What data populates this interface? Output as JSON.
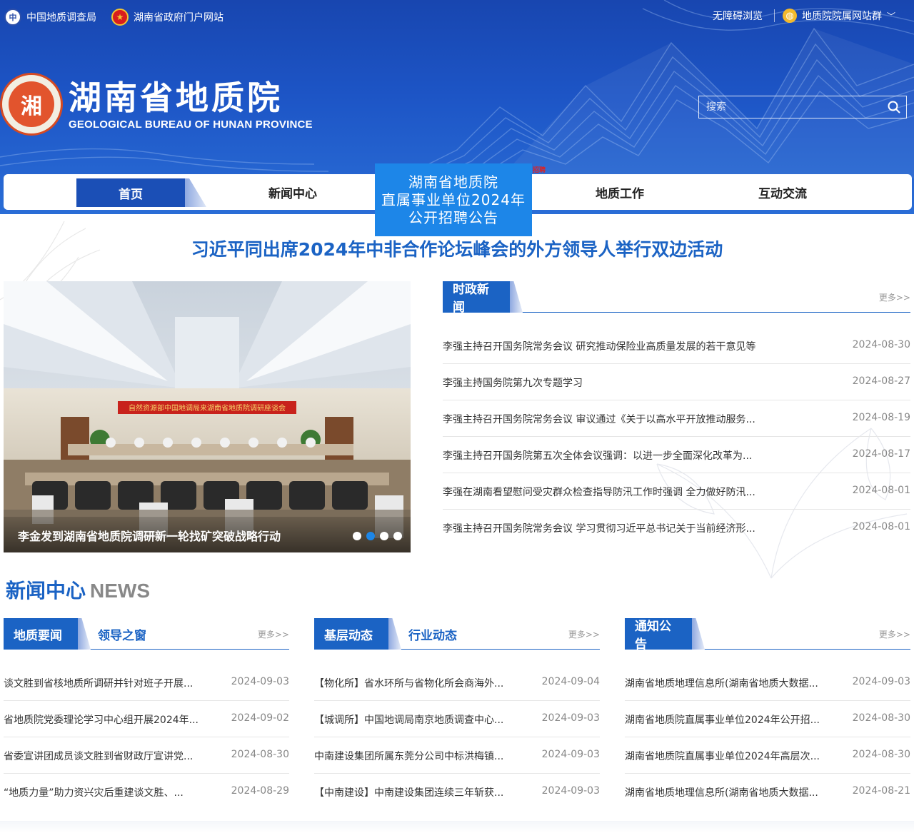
{
  "topbar": {
    "left_links": [
      "中国地质调查局",
      "湖南省政府门户网站"
    ],
    "accessibility": "无障碍浏览",
    "site_group": "地质院院属网站群"
  },
  "logo": {
    "cn": "湖南省地质院",
    "en": "GEOLOGICAL BUREAU OF HUNAN PROVINCE",
    "emblem": "湘"
  },
  "search": {
    "placeholder": "搜索"
  },
  "nav": {
    "items": [
      "首页",
      "新闻中心",
      "地质工作",
      "互动交流"
    ]
  },
  "recruit_popup": {
    "line1": "湖南省地质院",
    "line2": "直属事业单位2024年",
    "line3": "公开招聘公告",
    "tag": "招聘"
  },
  "headline": "习近平同出席2024年中非合作论坛峰会的外方领导人举行双边活动",
  "slideshow": {
    "banner_text": "自然资源部中国地调局来湖南省地质院调研座谈会",
    "caption": "李金发到湖南省地质院调研新一轮找矿突破战略行动"
  },
  "current_news": {
    "tab": "时政新闻",
    "more": "更多>>",
    "items": [
      {
        "title": "李强主持召开国务院常务会议 研究推动保险业高质量发展的若干意见等",
        "date": "2024-08-30"
      },
      {
        "title": "李强主持国务院第九次专题学习",
        "date": "2024-08-27"
      },
      {
        "title": "李强主持召开国务院常务会议 审议通过《关于以高水平开放推动服务...",
        "date": "2024-08-19"
      },
      {
        "title": "李强主持召开国务院第五次全体会议强调：以进一步全面深化改革为...",
        "date": "2024-08-17"
      },
      {
        "title": "李强在湖南看望慰问受灾群众检查指导防汛工作时强调 全力做好防汛...",
        "date": "2024-08-01"
      },
      {
        "title": "李强主持召开国务院常务会议 学习贯彻习近平总书记关于当前经济形...",
        "date": "2024-08-01"
      }
    ]
  },
  "news_center": {
    "title": "新闻中心",
    "title_en": "NEWS",
    "more": "更多>>",
    "col1": {
      "tabs": [
        "地质要闻",
        "领导之窗"
      ],
      "items": [
        {
          "title": "谈文胜到省核地质所调研并针对班子开展...",
          "date": "2024-09-03"
        },
        {
          "title": "省地质院党委理论学习中心组开展2024年...",
          "date": "2024-09-02"
        },
        {
          "title": "省委宣讲团成员谈文胜到省财政厅宣讲党...",
          "date": "2024-08-30"
        },
        {
          "title": "“地质力量”助力资兴灾后重建谈文胜、...",
          "date": "2024-08-29"
        }
      ]
    },
    "col2": {
      "tabs": [
        "基层动态",
        "行业动态"
      ],
      "items": [
        {
          "title": "【物化所】省水环所与省物化所会商海外...",
          "date": "2024-09-04"
        },
        {
          "title": "【城调所】中国地调局南京地质调查中心...",
          "date": "2024-09-03"
        },
        {
          "title": "中南建设集团所属东莞分公司中标洪梅镇...",
          "date": "2024-09-03"
        },
        {
          "title": "【中南建设】中南建设集团连续三年斩获...",
          "date": "2024-09-03"
        }
      ]
    },
    "col3": {
      "tabs": [
        "通知公告"
      ],
      "items": [
        {
          "title": "湖南省地质地理信息所(湖南省地质大数据...",
          "date": "2024-09-03"
        },
        {
          "title": "湖南省地质院直属事业单位2024年公开招...",
          "date": "2024-08-30"
        },
        {
          "title": "湖南省地质院直属事业单位2024年高层次...",
          "date": "2024-08-30"
        },
        {
          "title": "湖南省地质地理信息所(湖南省地质大数据...",
          "date": "2024-08-21"
        }
      ]
    }
  },
  "colors": {
    "brand_blue": "#1b63c4",
    "header_blue": "#1d55c6",
    "popup_blue": "#1d86e8"
  }
}
